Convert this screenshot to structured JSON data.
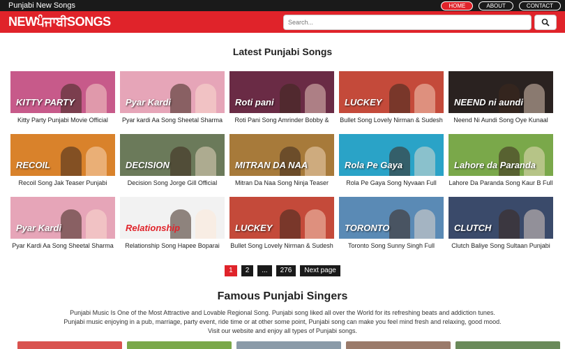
{
  "topbar": {
    "tagline": "Punjabi New Songs",
    "nav": [
      "HOME",
      "ABOUT",
      "CONTACT"
    ]
  },
  "header": {
    "logo": "NEWਪੰਜਾਬੀSONGS",
    "search_placeholder": "Search..."
  },
  "latest": {
    "title": "Latest Punjabi Songs",
    "songs": [
      {
        "caption": "Kitty Party Punjabi Movie Official",
        "thumb_text": "KITTY PARTY",
        "bg": "#c75a8a"
      },
      {
        "caption": "Pyar kardi Aa Song Sheetal Sharma",
        "thumb_text": "Pyar Kardi",
        "bg": "#e6a5b8"
      },
      {
        "caption": "Roti Pani Song Amrinder Bobby &",
        "thumb_text": "Roti pani",
        "bg": "#6a2b45"
      },
      {
        "caption": "Bullet Song Lovely Nirman & Sudesh",
        "thumb_text": "LUCKEY",
        "bg": "#c44a3a"
      },
      {
        "caption": "Neend Ni Aundi Song Oye Kunaal",
        "thumb_text": "NEEND ni aundi",
        "bg": "#2a2220"
      },
      {
        "caption": "Recoil Song Jak Teaser Punjabi",
        "thumb_text": "RECOIL",
        "bg": "#d9822b"
      },
      {
        "caption": "Decision Song Jorge Gill Official",
        "thumb_text": "DECISION",
        "bg": "#6b7a5a"
      },
      {
        "caption": "Mitran Da Naa Song Ninja Teaser",
        "thumb_text": "MITRAN DA NAA",
        "bg": "#a77a3a"
      },
      {
        "caption": "Rola Pe Gaya Song Nyvaan Full",
        "thumb_text": "Rola Pe Gaya",
        "bg": "#2aa3c7"
      },
      {
        "caption": "Lahore Da Paranda Song Kaur B Full",
        "thumb_text": "Lahore da Paranda",
        "bg": "#7aa84a"
      },
      {
        "caption": "Pyar Kardi Aa Song Sheetal Sharma",
        "thumb_text": "Pyar Kardi",
        "bg": "#e6a5b8"
      },
      {
        "caption": "Relationship Song Hapee Boparai",
        "thumb_text": "Relationship",
        "bg": "#f2f2f2"
      },
      {
        "caption": "Bullet Song Lovely Nirman & Sudesh",
        "thumb_text": "LUCKEY",
        "bg": "#c44a3a"
      },
      {
        "caption": "Toronto Song Sunny Singh Full",
        "thumb_text": "TORONTO",
        "bg": "#5a8ab5"
      },
      {
        "caption": "Clutch Baliye Song Sultaan Punjabi",
        "thumb_text": "CLUTCH",
        "bg": "#3a4a6a"
      }
    ]
  },
  "pagination": [
    "1",
    "2",
    "...",
    "276",
    "Next page"
  ],
  "singers": {
    "title": "Famous Punjabi Singers",
    "intro_lines": [
      "Punjabi Music Is One of the Most Attractive and Lovable Regional Song. Punjabi song liked all over the World for its refreshing beats and addiction tunes.",
      "Punjabi music enjoying in a pub, marriage, party event, ride time or at other some point, Punjabi song can make you feel mind fresh and relaxing, good mood.",
      "Visit our website and enjoy all types of Punjabi songs."
    ],
    "thumb_colors": [
      "#d9534f",
      "#7aa84a",
      "#8a9aa8",
      "#9a7a6a",
      "#6a8a5a"
    ]
  },
  "colors": {
    "accent": "#e0232a",
    "dark": "#1a1a1a"
  },
  "icons": {
    "search": "search-icon"
  }
}
